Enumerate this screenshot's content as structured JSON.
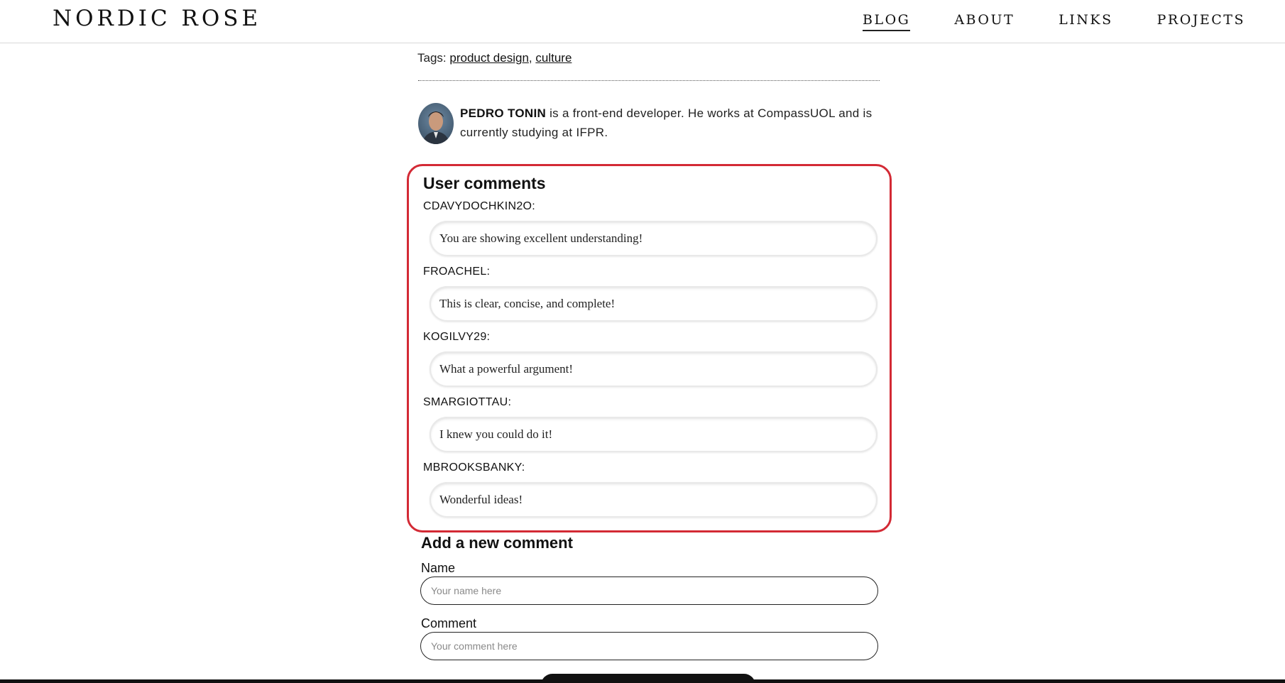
{
  "header": {
    "brand": "NORDIC ROSE",
    "nav": [
      {
        "label": "BLOG",
        "active": true
      },
      {
        "label": "ABOUT",
        "active": false
      },
      {
        "label": "LINKS",
        "active": false
      },
      {
        "label": "PROJECTS",
        "active": false
      }
    ]
  },
  "post": {
    "tags_label": "Tags:",
    "tags": [
      "product design",
      "culture"
    ],
    "tag_separator": ","
  },
  "author": {
    "name": "PEDRO TONIN",
    "bio": " is a front-end developer. He works at CompassUOL and is currently studying at IFPR."
  },
  "comments": {
    "title": "User comments",
    "items": [
      {
        "user": "CDAVYDOCHKIN2O:",
        "text": "You are showing excellent understanding!"
      },
      {
        "user": "FROACHEL:",
        "text": "This is clear, concise, and complete!"
      },
      {
        "user": "KOGILVY29:",
        "text": "What a powerful argument!"
      },
      {
        "user": "SMARGIOTTAU:",
        "text": "I knew you could do it!"
      },
      {
        "user": "MBROOKSBANKY:",
        "text": "Wonderful ideas!"
      }
    ]
  },
  "new_comment": {
    "title": "Add a new comment",
    "name_label": "Name",
    "name_placeholder": "Your name here",
    "comment_label": "Comment",
    "comment_placeholder": "Your comment here"
  },
  "colors": {
    "highlight_border": "#d32a35",
    "text": "#111111",
    "background": "#ffffff"
  }
}
